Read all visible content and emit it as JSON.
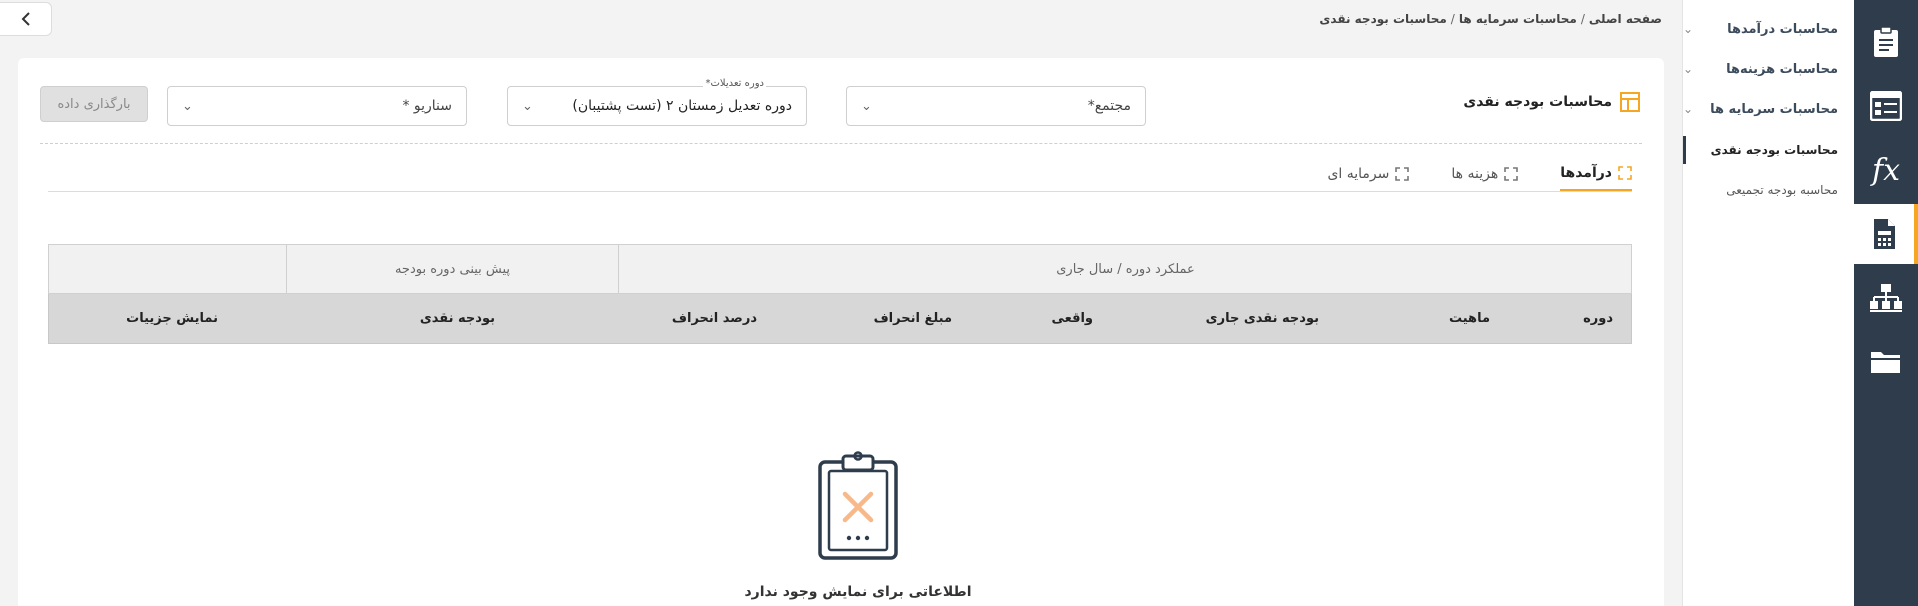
{
  "colors": {
    "rail_bg": "#2e3c4c",
    "accent": "#f5a623",
    "table_head": "#d7d7d7"
  },
  "breadcrumb": {
    "items": [
      "صفحه اصلی",
      "محاسبات سرمایه ها",
      "محاسبات بودجه نقدی"
    ],
    "separator": "/"
  },
  "back_button": {
    "icon": "chevron-left-icon",
    "label": "<"
  },
  "rail": {
    "items": [
      {
        "icon": "clipboard-icon"
      },
      {
        "icon": "form-list-icon"
      },
      {
        "icon": "fx-icon",
        "label": "fx"
      },
      {
        "icon": "calculator-document-icon",
        "active": true
      },
      {
        "icon": "org-chart-icon"
      },
      {
        "icon": "folder-icon"
      }
    ]
  },
  "menu": {
    "items": [
      {
        "label": "محاسبات درآمدها",
        "chevron": "⌄"
      },
      {
        "label": "محاسبات هزینه‌ها",
        "chevron": "⌄"
      },
      {
        "label": "محاسبات سرمایه ها",
        "chevron": "⌄"
      }
    ],
    "sub_items": [
      {
        "label": "محاسبات بودجه نقدی",
        "active": true
      },
      {
        "label": "محاسبه بودجه تجمیعی",
        "active": false
      }
    ]
  },
  "main": {
    "title": "محاسبات بودجه نقدی",
    "title_icon": "layout-grid-icon",
    "filters": {
      "complex": {
        "placeholder": "مجتمع*",
        "chevron": "⌄"
      },
      "period": {
        "floating_label": "دوره تعدیلات*",
        "value": "دوره تعدیل زمستان ۲ (تست پشتیبان)",
        "chevron": "⌄"
      },
      "scenario": {
        "placeholder": "سناریو *",
        "chevron": "⌄"
      }
    },
    "load_button": "بارگذاری داده",
    "tabs": [
      {
        "label": "درآمدها",
        "icon": "expand-icon",
        "active": true
      },
      {
        "label": "هزینه ها",
        "icon": "expand-icon",
        "active": false
      },
      {
        "label": "سرمایه ای",
        "icon": "expand-icon",
        "active": false
      }
    ],
    "table": {
      "group_headers": [
        "عملکرد دوره / سال جاری",
        "پیش بینی دوره بودجه",
        ""
      ],
      "columns": [
        "دوره",
        "ماهیت",
        "بودجه نقدی جاری",
        "واقعی",
        "مبلغ انحراف",
        "درصد انحراف",
        "بودجه نقدی",
        "نمایش جزییات"
      ]
    },
    "empty_state": {
      "icon": "empty-clipboard-icon",
      "text": "اطلاعاتی برای نمایش وجود ندارد"
    }
  }
}
